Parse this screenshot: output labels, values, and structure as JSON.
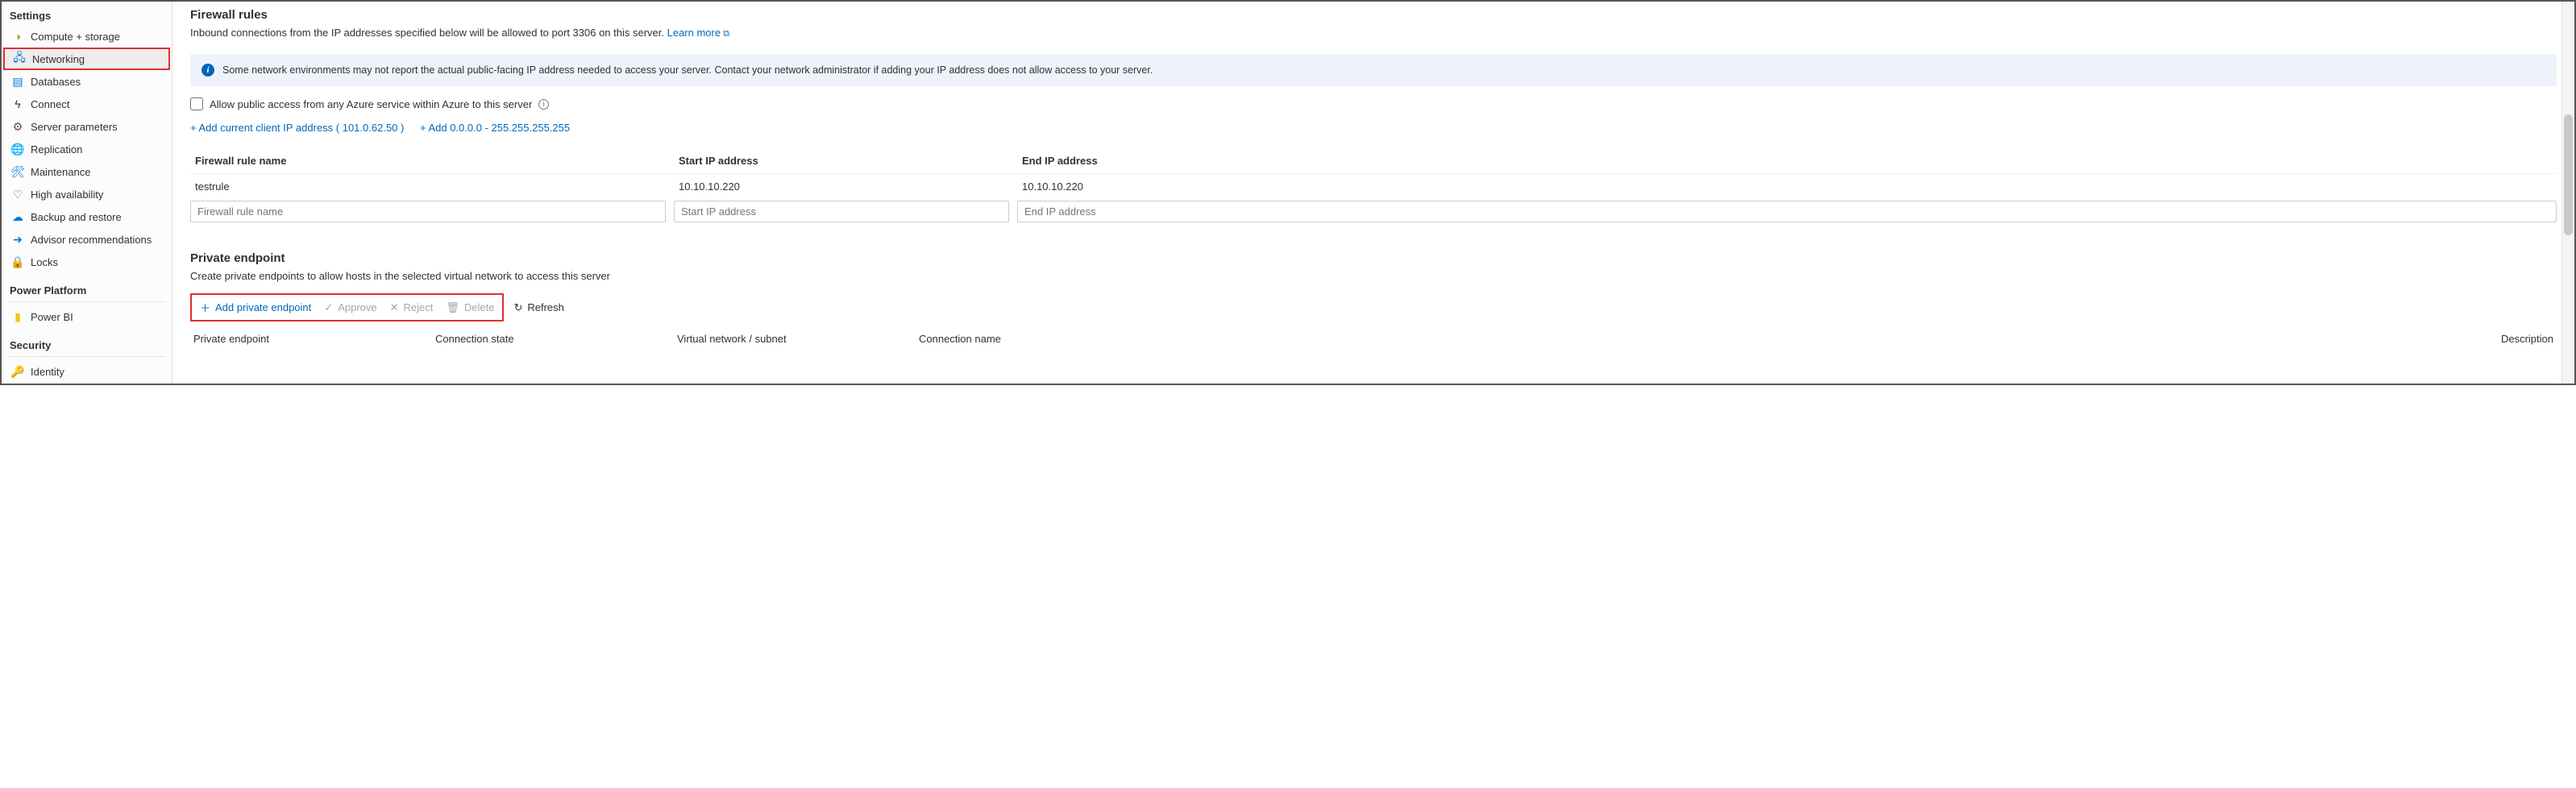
{
  "sidebar": {
    "sections": [
      {
        "header": "Settings",
        "items": [
          {
            "label": "Compute + storage",
            "icon": "⚙",
            "color": "#7fba00"
          },
          {
            "label": "Networking",
            "icon": "🌐",
            "color": "#0078d4",
            "active": true
          },
          {
            "label": "Databases",
            "icon": "▦",
            "color": "#0078d4"
          },
          {
            "label": "Connect",
            "icon": "⚡",
            "color": "#333"
          },
          {
            "label": "Server parameters",
            "icon": "⚙",
            "color": "#555"
          },
          {
            "label": "Replication",
            "icon": "🌍",
            "color": "#0078d4"
          },
          {
            "label": "Maintenance",
            "icon": "🛠",
            "color": "#0078d4"
          },
          {
            "label": "High availability",
            "icon": "❤",
            "color": "#0078d4"
          },
          {
            "label": "Backup and restore",
            "icon": "☁",
            "color": "#0078d4"
          },
          {
            "label": "Advisor recommendations",
            "icon": "➔",
            "color": "#0078d4"
          },
          {
            "label": "Locks",
            "icon": "🔒",
            "color": "#777"
          }
        ]
      },
      {
        "header": "Power Platform",
        "items": [
          {
            "label": "Power BI",
            "icon": "▮",
            "color": "#f2c811"
          }
        ]
      },
      {
        "header": "Security",
        "items": [
          {
            "label": "Identity",
            "icon": "🔑",
            "color": "#ffb900"
          }
        ]
      }
    ]
  },
  "firewall": {
    "title": "Firewall rules",
    "subtitle_prefix": "Inbound connections from the IP addresses specified below will be allowed to port 3306 on this server. ",
    "learn_more": "Learn more",
    "banner": "Some network environments may not report the actual public-facing IP address needed to access your server.  Contact your network administrator if adding your IP address does not allow access to your server.",
    "allow_azure": "Allow public access from any Azure service within Azure to this server",
    "add_client": "+ Add current client IP address ( 101.0.62.50 )",
    "add_range": "+ Add 0.0.0.0 - 255.255.255.255",
    "headers": {
      "name": "Firewall rule name",
      "start": "Start IP address",
      "end": "End IP address"
    },
    "rows": [
      {
        "name": "testrule",
        "start": "10.10.10.220",
        "end": "10.10.10.220"
      }
    ],
    "placeholders": {
      "name": "Firewall rule name",
      "start": "Start IP address",
      "end": "End IP address"
    }
  },
  "private_endpoint": {
    "title": "Private endpoint",
    "subtitle": "Create private endpoints to allow hosts in the selected virtual network to access this server",
    "toolbar": {
      "add": "Add private endpoint",
      "approve": "Approve",
      "reject": "Reject",
      "delete": "Delete",
      "refresh": "Refresh"
    },
    "headers": {
      "endpoint": "Private endpoint",
      "state": "Connection state",
      "vnet": "Virtual network / subnet",
      "conn_name": "Connection name",
      "desc": "Description"
    }
  }
}
